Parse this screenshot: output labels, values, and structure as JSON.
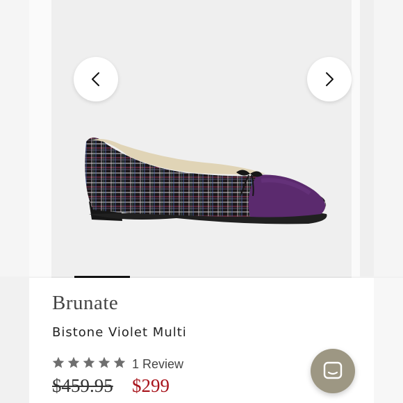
{
  "gallery": {
    "prev_icon": "chevron-left-icon",
    "next_icon": "chevron-right-icon",
    "active_slide_index": 0,
    "colors": {
      "upper_base": "#1a1518",
      "toe_cap": "#5b2a6e"
    }
  },
  "product": {
    "brand": "Brunate",
    "name": "Bistone Violet Multi",
    "rating": 5,
    "reviews_label": "1 Review",
    "original_price": "$459.95",
    "sale_price": "$299",
    "sale_color": "#a8141c"
  },
  "chat": {
    "icon": "chat-icon",
    "color": "#9d9783"
  }
}
